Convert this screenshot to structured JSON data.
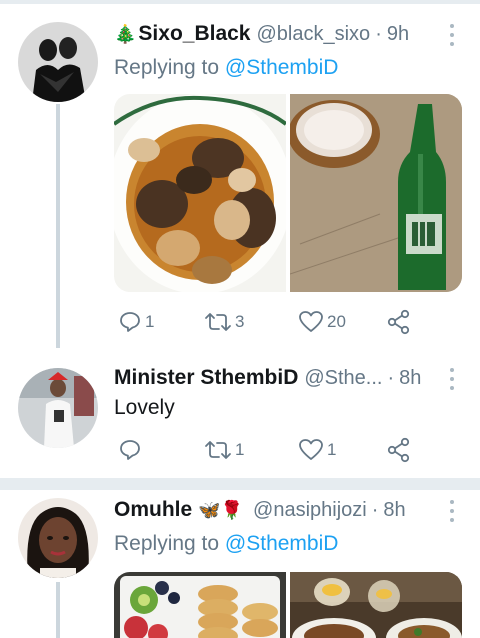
{
  "tweets": [
    {
      "emoji": "🎄",
      "name": "Sixo_Black",
      "handle": "@black_sixo",
      "time": "9h",
      "replying_label": "Replying to",
      "mention": "@SthembiD",
      "text": "",
      "replies": "1",
      "retweets": "3",
      "likes": "20"
    },
    {
      "emoji": "",
      "name": "Minister SthembiD",
      "handle": "@Sthe...",
      "time": "8h",
      "replying_label": "",
      "mention": "",
      "text": "Lovely",
      "replies": "",
      "retweets": "1",
      "likes": "1"
    },
    {
      "emoji": "",
      "name": "Omuhle",
      "name_emoji": "🦋🌹",
      "handle": "@nasiphijozi",
      "time": "8h",
      "replying_label": "Replying to",
      "mention": "@SthembiD",
      "text": "",
      "replies": "",
      "retweets": "",
      "likes": ""
    }
  ],
  "separator": "·",
  "colors": {
    "accent": "#1da1f2",
    "secondary_text": "#657786",
    "divider": "#e6ecf0"
  }
}
